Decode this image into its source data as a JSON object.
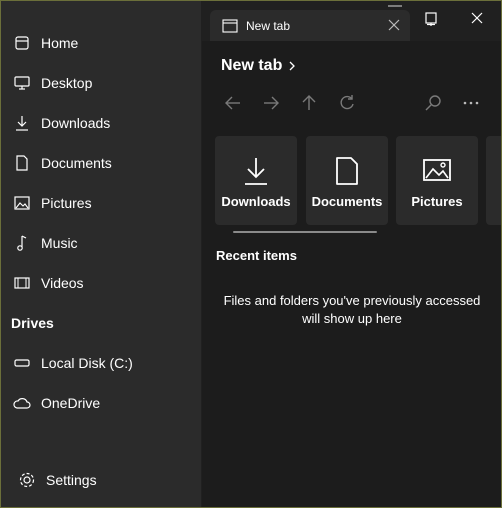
{
  "sidebar": {
    "items": [
      {
        "label": "Home",
        "icon": "home-icon"
      },
      {
        "label": "Desktop",
        "icon": "desktop-icon"
      },
      {
        "label": "Downloads",
        "icon": "download-icon"
      },
      {
        "label": "Documents",
        "icon": "document-icon"
      },
      {
        "label": "Pictures",
        "icon": "picture-icon"
      },
      {
        "label": "Music",
        "icon": "music-icon"
      },
      {
        "label": "Videos",
        "icon": "video-icon"
      }
    ],
    "drives_header": "Drives",
    "drives": [
      {
        "label": "Local Disk (C:)",
        "icon": "drive-icon"
      },
      {
        "label": "OneDrive",
        "icon": "cloud-icon"
      }
    ],
    "settings_label": "Settings"
  },
  "tab": {
    "label": "New tab"
  },
  "breadcrumb": {
    "label": "New tab"
  },
  "cards": [
    {
      "label": "Downloads",
      "icon": "download-icon"
    },
    {
      "label": "Documents",
      "icon": "document-icon"
    },
    {
      "label": "Pictures",
      "icon": "picture-icon"
    }
  ],
  "recent": {
    "title": "Recent items",
    "empty_message": "Files and folders you've previously accessed will show up here"
  },
  "colors": {
    "sidebar_bg": "#2b2b2b",
    "main_bg": "#1c1c1c",
    "window_border": "#6b6f3a",
    "toolbar_icon": "#7a7a7a"
  }
}
